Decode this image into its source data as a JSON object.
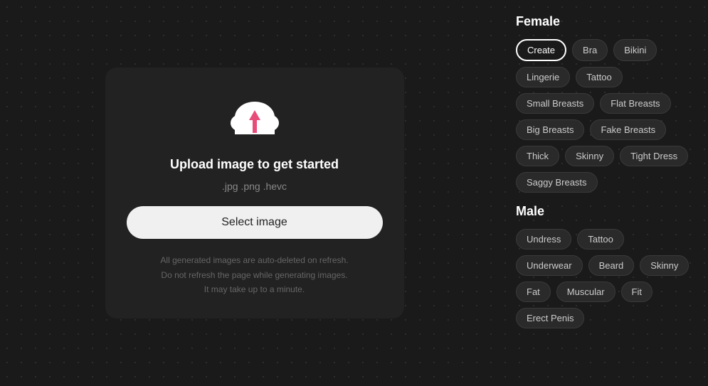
{
  "upload": {
    "title": "Upload image to get started",
    "formats": ".jpg .png .hevc",
    "select_label": "Select image",
    "notice_line1": "All generated images are auto-deleted on refresh.",
    "notice_line2": "Do not refresh the page while generating images.",
    "notice_line3": "It may take up to a minute."
  },
  "female_section": {
    "title": "Female",
    "tags": [
      {
        "label": "Create",
        "active": true
      },
      {
        "label": "Bra",
        "active": false
      },
      {
        "label": "Bikini",
        "active": false
      },
      {
        "label": "Lingerie",
        "active": false
      },
      {
        "label": "Tattoo",
        "active": false
      },
      {
        "label": "Small Breasts",
        "active": false
      },
      {
        "label": "Flat Breasts",
        "active": false
      },
      {
        "label": "Big Breasts",
        "active": false
      },
      {
        "label": "Fake Breasts",
        "active": false
      },
      {
        "label": "Thick",
        "active": false
      },
      {
        "label": "Skinny",
        "active": false
      },
      {
        "label": "Tight Dress",
        "active": false
      },
      {
        "label": "Saggy Breasts",
        "active": false
      }
    ]
  },
  "male_section": {
    "title": "Male",
    "tags": [
      {
        "label": "Undress",
        "active": false
      },
      {
        "label": "Tattoo",
        "active": false
      },
      {
        "label": "Underwear",
        "active": false
      },
      {
        "label": "Beard",
        "active": false
      },
      {
        "label": "Skinny",
        "active": false
      },
      {
        "label": "Fat",
        "active": false
      },
      {
        "label": "Muscular",
        "active": false
      },
      {
        "label": "Fit",
        "active": false
      },
      {
        "label": "Erect Penis",
        "active": false
      }
    ]
  }
}
